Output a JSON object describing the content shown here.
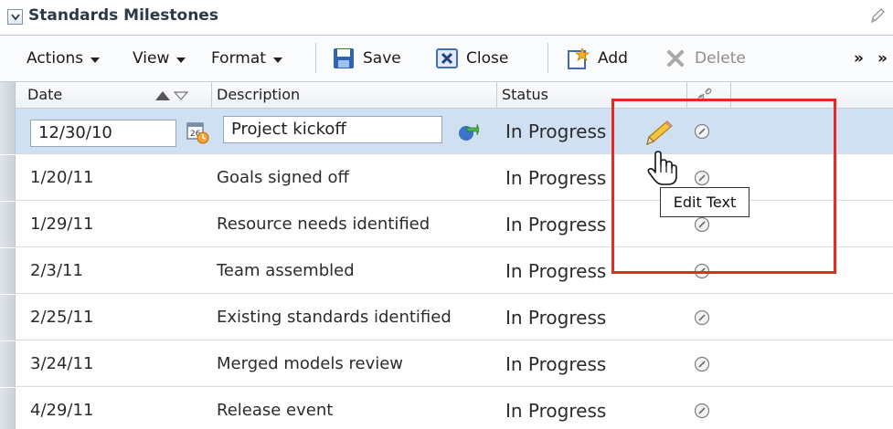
{
  "panel": {
    "title": "Standards Milestones",
    "collapse_icon": "chevron-down-icon",
    "edit_icon": "pencil-icon"
  },
  "toolbar": {
    "actions_label": "Actions",
    "view_label": "View",
    "format_label": "Format",
    "save_label": "Save",
    "close_label": "Close",
    "add_label": "Add",
    "delete_label": "Delete",
    "overflow_glyph": "»",
    "overflow_glyph_2": "»"
  },
  "table": {
    "columns": {
      "date": "Date",
      "description": "Description",
      "status": "Status",
      "link_icon": "link-icon"
    },
    "editing": {
      "date_value": "12/30/10",
      "description_value": "Project kickoff",
      "status": "In Progress"
    },
    "rows": [
      {
        "date": "1/20/11",
        "description": "Goals signed off",
        "status": "In Progress"
      },
      {
        "date": "1/29/11",
        "description": "Resource needs identified",
        "status": "In Progress"
      },
      {
        "date": "2/3/11",
        "description": "Team assembled",
        "status": "In Progress"
      },
      {
        "date": "2/25/11",
        "description": "Existing standards identified",
        "status": "In Progress"
      },
      {
        "date": "3/24/11",
        "description": "Merged models review",
        "status": "In Progress"
      },
      {
        "date": "4/29/11",
        "description": "Release event",
        "status": "In Progress"
      }
    ]
  },
  "tooltip": {
    "text": "Edit Text"
  },
  "colors": {
    "selected_row": "#cfe0f3",
    "highlight_box": "#e32b24"
  }
}
